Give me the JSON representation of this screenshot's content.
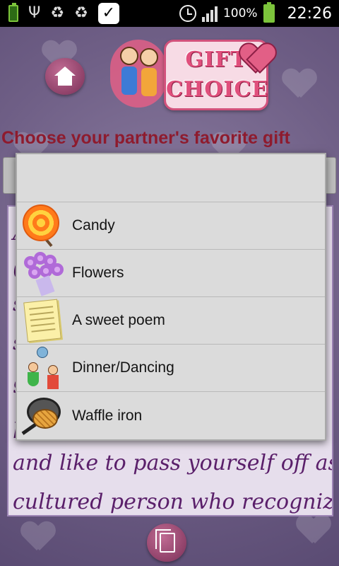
{
  "status_bar": {
    "battery_small_label": "100%",
    "battery_percent": "100%",
    "time": "22:26"
  },
  "app": {
    "logo_line1": "GIFT",
    "logo_line2": "CHOICE",
    "prompt": "Choose your partner's favorite gift",
    "background_text": [
      "A",
      "(",
      "s",
      "s",
      "g",
      "h",
      "and like to pass yourself off as a",
      "cultured person who recognizes"
    ]
  },
  "dialog": {
    "options": [
      {
        "label": "Candy",
        "icon": "candy-icon"
      },
      {
        "label": "Flowers",
        "icon": "flowers-icon"
      },
      {
        "label": "A sweet poem",
        "icon": "poem-icon"
      },
      {
        "label": "Dinner/Dancing",
        "icon": "dinner-dancing-icon"
      },
      {
        "label": "Waffle iron",
        "icon": "waffle-iron-icon"
      }
    ]
  },
  "colors": {
    "prompt_text": "#8e1b2e",
    "script_text": "#5a1f6a",
    "dialog_bg": "#dbdbdb",
    "battery_green": "#7cc43b"
  }
}
